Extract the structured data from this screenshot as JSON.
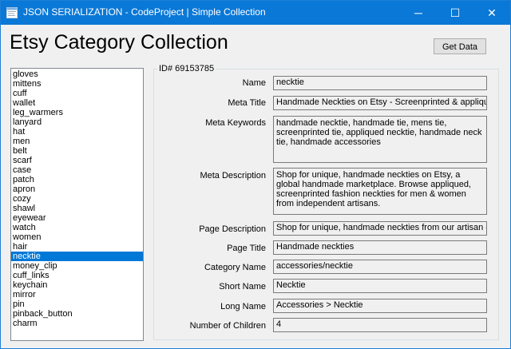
{
  "window": {
    "title": "JSON SERIALIZATION - CodeProject | Simple Collection",
    "minimize_glyph": "─",
    "maximize_glyph": "☐",
    "close_glyph": "✕",
    "app_icon": "winforms-app-icon"
  },
  "heading": "Etsy Category Collection",
  "get_data_label": "Get Data",
  "categories": {
    "items": [
      "gloves",
      "mittens",
      "cuff",
      "wallet",
      "leg_warmers",
      "lanyard",
      "hat",
      "men",
      "belt",
      "scarf",
      "case",
      "patch",
      "apron",
      "cozy",
      "shawl",
      "eyewear",
      "watch",
      "women",
      "hair",
      "necktie",
      "money_clip",
      "cuff_links",
      "keychain",
      "mirror",
      "pin",
      "pinback_button",
      "charm"
    ],
    "selected": "necktie",
    "selected_color": "#0078d7"
  },
  "details": {
    "group_label": "ID# 69153785",
    "name_label": "Name",
    "name": "necktie",
    "meta_title_label": "Meta Title",
    "meta_title": "Handmade Neckties on Etsy - Screenprinted & applique ties",
    "meta_keywords_label": "Meta Keywords",
    "meta_keywords": "handmade necktie, handmade tie, mens tie, screenprinted tie, appliqued necktie, handmade neck tie, handmade accessories",
    "meta_description_label": "Meta Description",
    "meta_description": "Shop for unique, handmade neckties on Etsy, a global handmade marketplace. Browse appliqued, screenprinted fashion neckties for men & women from independent artisans.",
    "page_description_label": "Page Description",
    "page_description": "Shop for unique, handmade neckties from our artisan community",
    "page_title_label": "Page Title",
    "page_title": "Handmade neckties",
    "category_name_label": "Category Name",
    "category_name": "accessories/necktie",
    "short_name_label": "Short Name",
    "short_name": "Necktie",
    "long_name_label": "Long Name",
    "long_name": "Accessories > Necktie",
    "num_children_label": "Number of Children",
    "num_children": "4"
  },
  "colors": {
    "titlebar": "#0a78d7",
    "window_bg": "#f0f0f0"
  }
}
